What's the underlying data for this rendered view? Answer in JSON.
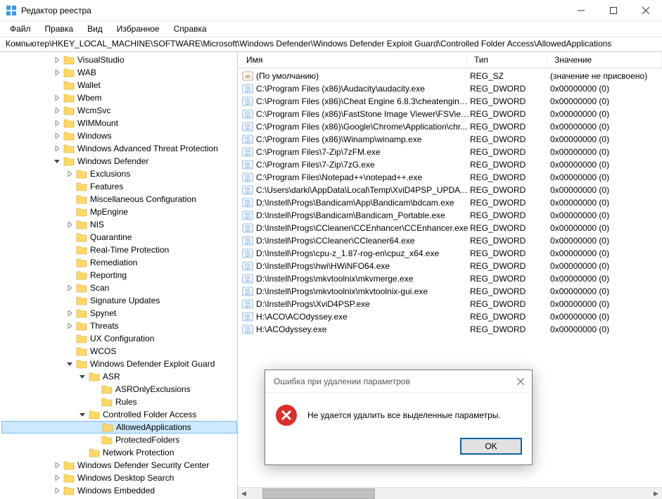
{
  "window": {
    "title": "Редактор реестра"
  },
  "menu": {
    "file": "Файл",
    "edit": "Правка",
    "view": "Вид",
    "favorites": "Избранное",
    "help": "Справка"
  },
  "address": {
    "path": "Компьютер\\HKEY_LOCAL_MACHINE\\SOFTWARE\\Microsoft\\Windows Defender\\Windows Defender Exploit Guard\\Controlled Folder Access\\AllowedApplications"
  },
  "columns": {
    "name": "Имя",
    "type": "Тип",
    "value": "Значение"
  },
  "values": [
    {
      "name": "(По умолчанию)",
      "type": "REG_SZ",
      "data": "(значение не присвоено)",
      "icontype": "sz"
    },
    {
      "name": "C:\\Program Files (x86)\\Audacity\\audacity.exe",
      "type": "REG_DWORD",
      "data": "0x00000000 (0)",
      "icontype": "bin"
    },
    {
      "name": "C:\\Program Files (x86)\\Cheat Engine 6.8.3\\cheatengine-...",
      "type": "REG_DWORD",
      "data": "0x00000000 (0)",
      "icontype": "bin"
    },
    {
      "name": "C:\\Program Files (x86)\\FastStone Image Viewer\\FSViewe...",
      "type": "REG_DWORD",
      "data": "0x00000000 (0)",
      "icontype": "bin"
    },
    {
      "name": "C:\\Program Files (x86)\\Google\\Chrome\\Application\\chr...",
      "type": "REG_DWORD",
      "data": "0x00000000 (0)",
      "icontype": "bin"
    },
    {
      "name": "C:\\Program Files (x86)\\Winamp\\winamp.exe",
      "type": "REG_DWORD",
      "data": "0x00000000 (0)",
      "icontype": "bin"
    },
    {
      "name": "C:\\Program Files\\7-Zip\\7zFM.exe",
      "type": "REG_DWORD",
      "data": "0x00000000 (0)",
      "icontype": "bin"
    },
    {
      "name": "C:\\Program Files\\7-Zip\\7zG.exe",
      "type": "REG_DWORD",
      "data": "0x00000000 (0)",
      "icontype": "bin"
    },
    {
      "name": "C:\\Program Files\\Notepad++\\notepad++.exe",
      "type": "REG_DWORD",
      "data": "0x00000000 (0)",
      "icontype": "bin"
    },
    {
      "name": "C:\\Users\\darki\\AppData\\Local\\Temp\\XviD4PSP_UPDAT...",
      "type": "REG_DWORD",
      "data": "0x00000000 (0)",
      "icontype": "bin"
    },
    {
      "name": "D:\\Instell\\Progs\\Bandicam\\App\\Bandicam\\bdcam.exe",
      "type": "REG_DWORD",
      "data": "0x00000000 (0)",
      "icontype": "bin"
    },
    {
      "name": "D:\\Instell\\Progs\\Bandicam\\Bandicam_Portable.exe",
      "type": "REG_DWORD",
      "data": "0x00000000 (0)",
      "icontype": "bin"
    },
    {
      "name": "D:\\Instell\\Progs\\CCleaner\\CCEnhancer\\CCEnhancer.exe",
      "type": "REG_DWORD",
      "data": "0x00000000 (0)",
      "icontype": "bin"
    },
    {
      "name": "D:\\Instell\\Progs\\CCleaner\\CCleaner64.exe",
      "type": "REG_DWORD",
      "data": "0x00000000 (0)",
      "icontype": "bin"
    },
    {
      "name": "D:\\Instell\\Progs\\cpu-z_1.87-rog-en\\cpuz_x64.exe",
      "type": "REG_DWORD",
      "data": "0x00000000 (0)",
      "icontype": "bin"
    },
    {
      "name": "D:\\Instell\\Progs\\hwi\\HWiNFO64.exe",
      "type": "REG_DWORD",
      "data": "0x00000000 (0)",
      "icontype": "bin"
    },
    {
      "name": "D:\\Instell\\Progs\\mkvtoolnix\\mkvmerge.exe",
      "type": "REG_DWORD",
      "data": "0x00000000 (0)",
      "icontype": "bin"
    },
    {
      "name": "D:\\Instell\\Progs\\mkvtoolnix\\mkvtoolnix-gui.exe",
      "type": "REG_DWORD",
      "data": "0x00000000 (0)",
      "icontype": "bin"
    },
    {
      "name": "D:\\Instell\\Progs\\XviD4PSP.exe",
      "type": "REG_DWORD",
      "data": "0x00000000 (0)",
      "icontype": "bin"
    },
    {
      "name": "H:\\ACO\\ACOdyssey.exe",
      "type": "REG_DWORD",
      "data": "0x00000000 (0)",
      "icontype": "bin"
    },
    {
      "name": "H:\\ACOdyssey.exe",
      "type": "REG_DWORD",
      "data": "0x00000000 (0)",
      "icontype": "bin"
    }
  ],
  "tree": [
    {
      "d": 4,
      "e": "r",
      "l": "VisualStudio"
    },
    {
      "d": 4,
      "e": "r",
      "l": "WAB"
    },
    {
      "d": 4,
      "e": "",
      "l": "Wallet"
    },
    {
      "d": 4,
      "e": "r",
      "l": "Wbem"
    },
    {
      "d": 4,
      "e": "r",
      "l": "WcmSvc"
    },
    {
      "d": 4,
      "e": "r",
      "l": "WIMMount"
    },
    {
      "d": 4,
      "e": "r",
      "l": "Windows"
    },
    {
      "d": 4,
      "e": "r",
      "l": "Windows Advanced Threat Protection"
    },
    {
      "d": 4,
      "e": "d",
      "l": "Windows Defender"
    },
    {
      "d": 5,
      "e": "r",
      "l": "Exclusions"
    },
    {
      "d": 5,
      "e": "",
      "l": "Features"
    },
    {
      "d": 5,
      "e": "",
      "l": "Miscellaneous Configuration"
    },
    {
      "d": 5,
      "e": "",
      "l": "MpEngine"
    },
    {
      "d": 5,
      "e": "r",
      "l": "NIS"
    },
    {
      "d": 5,
      "e": "",
      "l": "Quarantine"
    },
    {
      "d": 5,
      "e": "",
      "l": "Real-Time Protection"
    },
    {
      "d": 5,
      "e": "",
      "l": "Remediation"
    },
    {
      "d": 5,
      "e": "",
      "l": "Reporting"
    },
    {
      "d": 5,
      "e": "r",
      "l": "Scan"
    },
    {
      "d": 5,
      "e": "",
      "l": "Signature Updates"
    },
    {
      "d": 5,
      "e": "r",
      "l": "Spynet"
    },
    {
      "d": 5,
      "e": "r",
      "l": "Threats"
    },
    {
      "d": 5,
      "e": "",
      "l": "UX Configuration"
    },
    {
      "d": 5,
      "e": "",
      "l": "WCOS"
    },
    {
      "d": 5,
      "e": "d",
      "l": "Windows Defender Exploit Guard"
    },
    {
      "d": 6,
      "e": "d",
      "l": "ASR"
    },
    {
      "d": 7,
      "e": "",
      "l": "ASROnlyExclusions"
    },
    {
      "d": 7,
      "e": "",
      "l": "Rules"
    },
    {
      "d": 6,
      "e": "d",
      "l": "Controlled Folder Access"
    },
    {
      "d": 7,
      "e": "",
      "l": "AllowedApplications",
      "sel": true
    },
    {
      "d": 7,
      "e": "",
      "l": "ProtectedFolders"
    },
    {
      "d": 6,
      "e": "",
      "l": "Network Protection"
    },
    {
      "d": 4,
      "e": "r",
      "l": "Windows Defender Security Center"
    },
    {
      "d": 4,
      "e": "r",
      "l": "Windows Desktop Search"
    },
    {
      "d": 4,
      "e": "r",
      "l": "Windows Embedded"
    }
  ],
  "dialog": {
    "title": "Ошибка при удалении параметров",
    "message": "Не удается удалить все выделенные параметры.",
    "ok": "OK"
  }
}
